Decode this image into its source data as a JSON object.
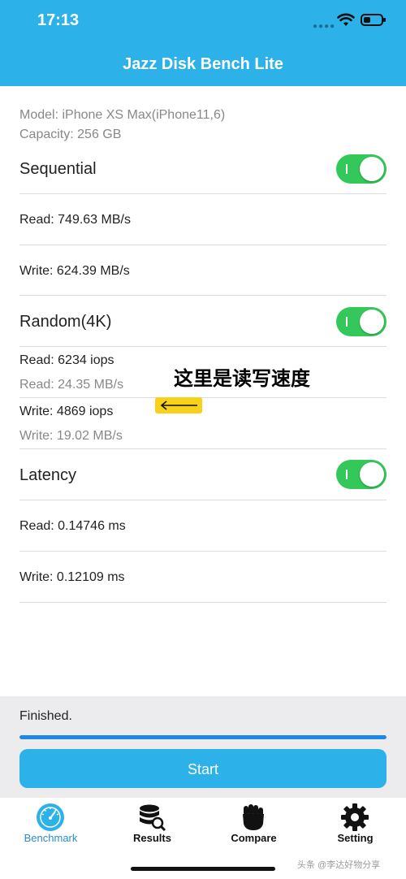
{
  "status_bar": {
    "time": "17:13"
  },
  "app": {
    "title": "Jazz Disk Bench Lite"
  },
  "device": {
    "model": "Model: iPhone XS Max(iPhone11,6)",
    "capacity": "Capacity: 256 GB"
  },
  "sections": {
    "sequential": {
      "title": "Sequential",
      "enabled": true,
      "read": "Read: 749.63 MB/s",
      "write": "Write: 624.39 MB/s"
    },
    "random": {
      "title": "Random(4K)",
      "enabled": true,
      "read_iops": "Read: 6234 iops",
      "read_speed": "Read: 24.35 MB/s",
      "write_iops": "Write: 4869 iops",
      "write_speed": "Write: 19.02 MB/s"
    },
    "latency": {
      "title": "Latency",
      "enabled": true,
      "read": "Read: 0.14746 ms",
      "write": "Write: 0.12109 ms"
    }
  },
  "annotation": {
    "text": "这里是读写速度"
  },
  "footer": {
    "status": "Finished.",
    "progress_percent": 100,
    "start_label": "Start"
  },
  "tabs": [
    {
      "label": "Benchmark",
      "icon": "speedometer-icon",
      "active": true
    },
    {
      "label": "Results",
      "icon": "database-search-icon",
      "active": false
    },
    {
      "label": "Compare",
      "icon": "fist-icon",
      "active": false
    },
    {
      "label": "Setting",
      "icon": "gear-icon",
      "active": false
    }
  ],
  "watermark": "头条 @李达好物分享",
  "colors": {
    "header": "#2cb1e9",
    "toggle_on": "#34c759",
    "progress": "#1e88e5",
    "highlight": "#f7d11a"
  }
}
